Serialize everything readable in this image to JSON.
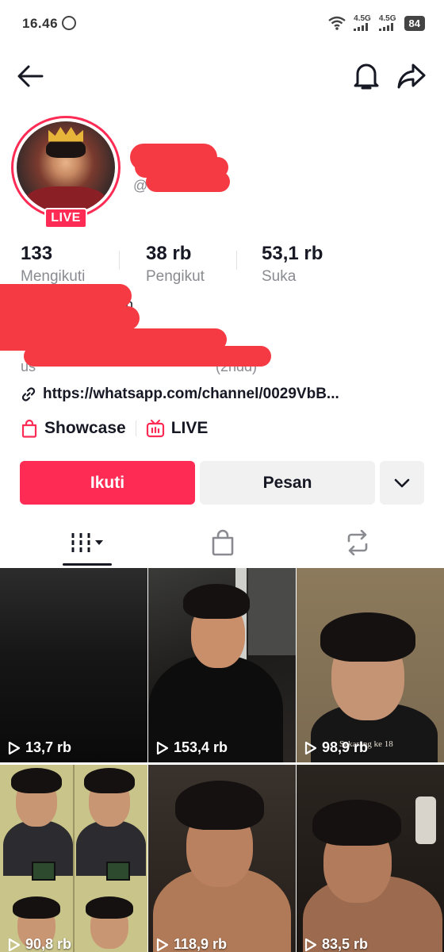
{
  "status_bar": {
    "time": "16.46",
    "network_1": "4.5G",
    "network_2": "4.5G",
    "battery": "84"
  },
  "nav": {
    "back_icon": "arrow-left-icon",
    "bell_icon": "bell-icon",
    "share_icon": "share-arrow-icon"
  },
  "profile": {
    "live_badge": "LIVE",
    "username_prefix": "@",
    "colors": {
      "accent": "#fe2c55",
      "redaction": "#f53a43"
    }
  },
  "stats": [
    {
      "value": "133",
      "label": "Mengikuti"
    },
    {
      "value": "38 rb",
      "label": "Pengikut"
    },
    {
      "value": "53,1 rb",
      "label": "Suka"
    }
  ],
  "bio": {
    "line_1_visible": "ah",
    "line_2_visible": "us",
    "line_2_tail": "(2ndd)",
    "link": "https://whatsapp.com/channel/0029VbB..."
  },
  "tools": [
    {
      "icon": "shopping-bag-icon",
      "label": "Showcase"
    },
    {
      "icon": "live-tv-icon",
      "label": "LIVE"
    }
  ],
  "actions": {
    "follow": "Ikuti",
    "message": "Pesan",
    "more_icon": "chevron-down-icon"
  },
  "tabs": [
    {
      "icon": "grid-videos-icon",
      "active": true
    },
    {
      "icon": "shop-bag-icon",
      "active": false
    },
    {
      "icon": "repost-icon",
      "active": false
    }
  ],
  "videos": [
    {
      "views": "13,7 rb"
    },
    {
      "views": "153,4 rb"
    },
    {
      "views": "98,9 rb",
      "overlay_text": "Sekarang ke 18"
    },
    {
      "views": "90,8 rb"
    },
    {
      "views": "118,9 rb"
    },
    {
      "views": "83,5 rb"
    }
  ]
}
